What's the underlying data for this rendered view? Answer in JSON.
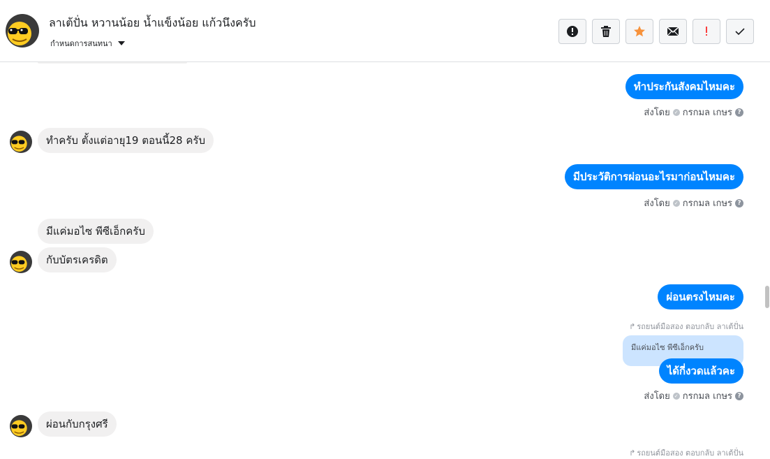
{
  "header": {
    "title": "ลาเต้ปั่น หวานน้อย น้ำแข็งน้อย แก้วนึงครับ",
    "conversation_settings": "กำหนดการสนทนา"
  },
  "toolbar": {
    "buttons": [
      {
        "name": "spam-button",
        "icon": "exclamation-circle-icon"
      },
      {
        "name": "delete-button",
        "icon": "trash-icon"
      },
      {
        "name": "star-button",
        "icon": "star-icon",
        "color": "#f7923b"
      },
      {
        "name": "mark-unread-button",
        "icon": "envelope-icon"
      },
      {
        "name": "follow-up-button",
        "icon": "exclamation-icon",
        "color": "#fa3e3e"
      },
      {
        "name": "done-button",
        "icon": "check-icon"
      }
    ]
  },
  "sent_by": {
    "prefix": "ส่งโดย",
    "name": "กรกมล เกษร",
    "help": "?"
  },
  "messages": [
    {
      "dir": "out",
      "text": "ทำประกันสังคมไหมคะ"
    },
    {
      "dir": "in",
      "text": "ทำครับ ตั้งแต่อายุ19 ตอนนี้28 ครับ"
    },
    {
      "dir": "out",
      "text": "มีประวัติการผ่อนอะไรมาก่อนไหมคะ"
    },
    {
      "dir": "in",
      "text": "มีแค่มอไซ พีซีเอ็กครับ"
    },
    {
      "dir": "in",
      "text": "กับบัตรเครดิต"
    },
    {
      "dir": "out",
      "text": "ผ่อนตรงไหมคะ"
    },
    {
      "dir": "out",
      "text": "ได้กี่งวดแล้วคะ"
    },
    {
      "dir": "in",
      "text": "ผ่อนกับกรุงศรี"
    }
  ],
  "reply_notes": [
    "รถยนต์มือสอง ตอบกลับ ลาเต้ปั่น",
    "รถยนต์มือสอง ตอบกลับ ลาเต้ปั่น"
  ],
  "quoted_text": "มีแค่มอไซ พีซีเอ็กครับ",
  "colors": {
    "outgoing_bubble": "#0084ff",
    "incoming_bubble": "#f1f0f0",
    "quoted_bubble": "#cce4ff"
  }
}
